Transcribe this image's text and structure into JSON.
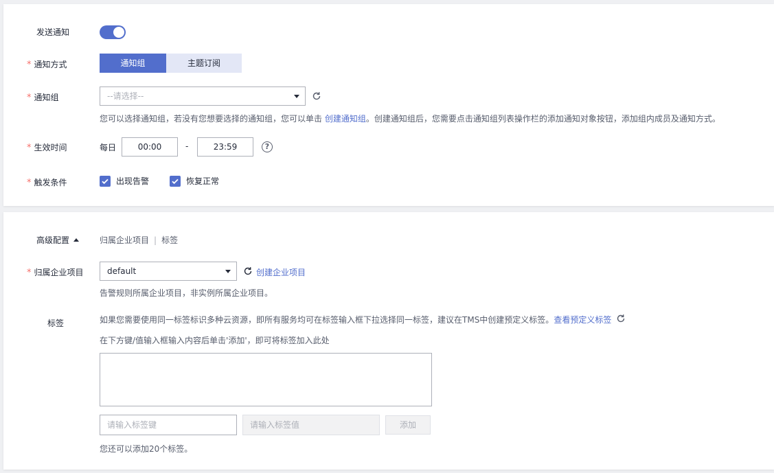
{
  "notify": {
    "send_label": "发送通知",
    "send_enabled": true,
    "method_label": "通知方式",
    "method_options": [
      "通知组",
      "主题订阅"
    ],
    "group_label": "通知组",
    "group_placeholder": "--请选择--",
    "group_hint_before": "您可以选择通知组，若没有您想要选择的通知组，您可以单击 ",
    "group_hint_link": "创建通知组",
    "group_hint_after": "。创建通知组后，您需要点击通知组列表操作栏的添加通知对象按钮，添加组内成员及通知方式。",
    "time_label": "生效时间",
    "time_prefix": "每日",
    "time_start": "00:00",
    "time_separator": "-",
    "time_end": "23:59",
    "help_glyph": "?",
    "trigger_label": "触发条件",
    "trigger_options": [
      "出现告警",
      "恢复正常"
    ]
  },
  "advanced": {
    "title": "高级配置",
    "tabs": [
      "归属企业项目",
      "标签"
    ],
    "tab_separator": "|",
    "project_label": "归属企业项目",
    "project_value": "default",
    "project_create_link": "创建企业项目",
    "project_hint": "告警规则所属企业项目，非实例所属企业项目。",
    "tag_label": "标签",
    "tag_hint_before": "如果您需要使用同一标签标识多种云资源，即所有服务均可在标签输入框下拉选择同一标签，建议在TMS中创建预定义标签。",
    "tag_hint_link": "查看预定义标签",
    "tag_hint2": "在下方键/值输入框输入内容后单击'添加'，即可将标签加入此处",
    "key_placeholder": "请输入标签键",
    "value_placeholder": "请输入标签值",
    "add_label": "添加",
    "remaining_hint": "您还可以添加20个标签。"
  },
  "colors": {
    "primary": "#526ecc",
    "required": "#f66f6a",
    "text": "#252b3a"
  }
}
